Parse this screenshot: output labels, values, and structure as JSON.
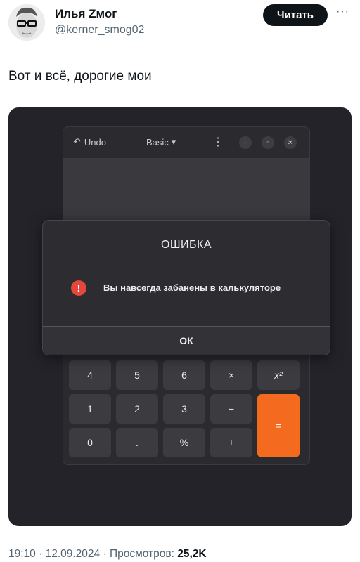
{
  "author": {
    "name": "Илья Zмог",
    "handle": "@kerner_smog02"
  },
  "follow_label": "Читать",
  "more_label": "···",
  "post_text": "Вот и всё, дорогие мои",
  "calculator": {
    "undo_label": "Undo",
    "mode_label": "Basic",
    "keys": [
      "4",
      "5",
      "6",
      "×",
      "x²",
      "1",
      "2",
      "3",
      "−",
      "=",
      "0",
      ".",
      "%",
      "+"
    ]
  },
  "dialog": {
    "title": "ОШИБКА",
    "message": "Вы навсегда забанены в калькуляторе",
    "ok_label": "ОК"
  },
  "footer": {
    "time": "19:10",
    "date": "12.09.2024",
    "views_label": "Просмотров:",
    "views_count": "25,2K"
  }
}
